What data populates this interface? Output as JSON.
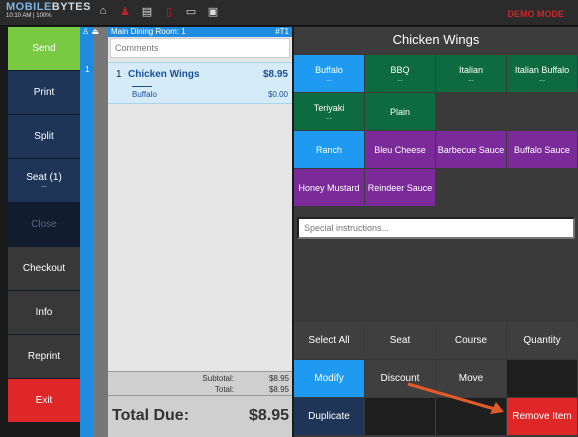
{
  "topbar": {
    "logo_a": "MOBILE",
    "logo_b": "BYTES",
    "status": "10:10 AM | 100%",
    "mode": "DEMO MODE",
    "icons": [
      "home-icon",
      "person-icon",
      "drawer-icon",
      "mobile-icon",
      "chat-icon",
      "display-icon"
    ]
  },
  "sidebar": {
    "items": [
      {
        "label": "Send"
      },
      {
        "label": "Print"
      },
      {
        "label": "Split"
      },
      {
        "label": "Seat (1)",
        "dots": "..."
      },
      {
        "label": "Close"
      },
      {
        "label": "Checkout"
      },
      {
        "label": "Info"
      },
      {
        "label": "Reprint"
      },
      {
        "label": "Exit"
      }
    ]
  },
  "order": {
    "room": "Main Dining Room: 1",
    "table": "#T1",
    "seat_number": "1",
    "comments_placeholder": "Comments",
    "item": {
      "qty": "1",
      "name": "Chicken Wings",
      "price": "$8.95",
      "modifier": "Buffalo",
      "modifier_price": "$0.00"
    },
    "subtotal_label": "Subtotal:",
    "subtotal": "$8.95",
    "total_label": "Total:",
    "total": "$8.95",
    "due_label": "Total Due:",
    "due": "$8.95"
  },
  "modifiers": {
    "title": "Chicken Wings",
    "rows": [
      [
        {
          "label": "Buffalo",
          "dots": "...",
          "color": "blue"
        },
        {
          "label": "BBQ",
          "dots": "...",
          "color": "green"
        },
        {
          "label": "Italian",
          "dots": "...",
          "color": "green"
        },
        {
          "label": "Italian Buffalo",
          "dots": "...",
          "color": "green"
        }
      ],
      [
        {
          "label": "Teriyaki",
          "dots": "...",
          "color": "green"
        },
        {
          "label": "Plain",
          "dots": "",
          "color": "green"
        }
      ],
      [
        {
          "label": "Ranch",
          "color": "blue"
        },
        {
          "label": "Bleu Cheese",
          "color": "purple"
        },
        {
          "label": "Barbecue Sauce",
          "color": "purple"
        },
        {
          "label": "Buffalo Sauce",
          "color": "purple"
        }
      ],
      [
        {
          "label": "Honey Mustard",
          "color": "purple"
        },
        {
          "label": "Reindeer Sauce",
          "color": "purple"
        }
      ]
    ],
    "special_placeholder": "Special instructions..."
  },
  "actions": {
    "select_all": "Select All",
    "seat": "Seat",
    "course": "Course",
    "quantity": "Quantity",
    "modify": "Modify",
    "discount": "Discount",
    "move": "Move",
    "duplicate": "Duplicate",
    "remove_item": "Remove Item"
  },
  "colors": {
    "send": "#7ac943",
    "nav": "#1f3557",
    "blue": "#1e9bf0",
    "green": "#0e6b3f",
    "purple": "#7b2a9a",
    "red": "#e02727"
  }
}
